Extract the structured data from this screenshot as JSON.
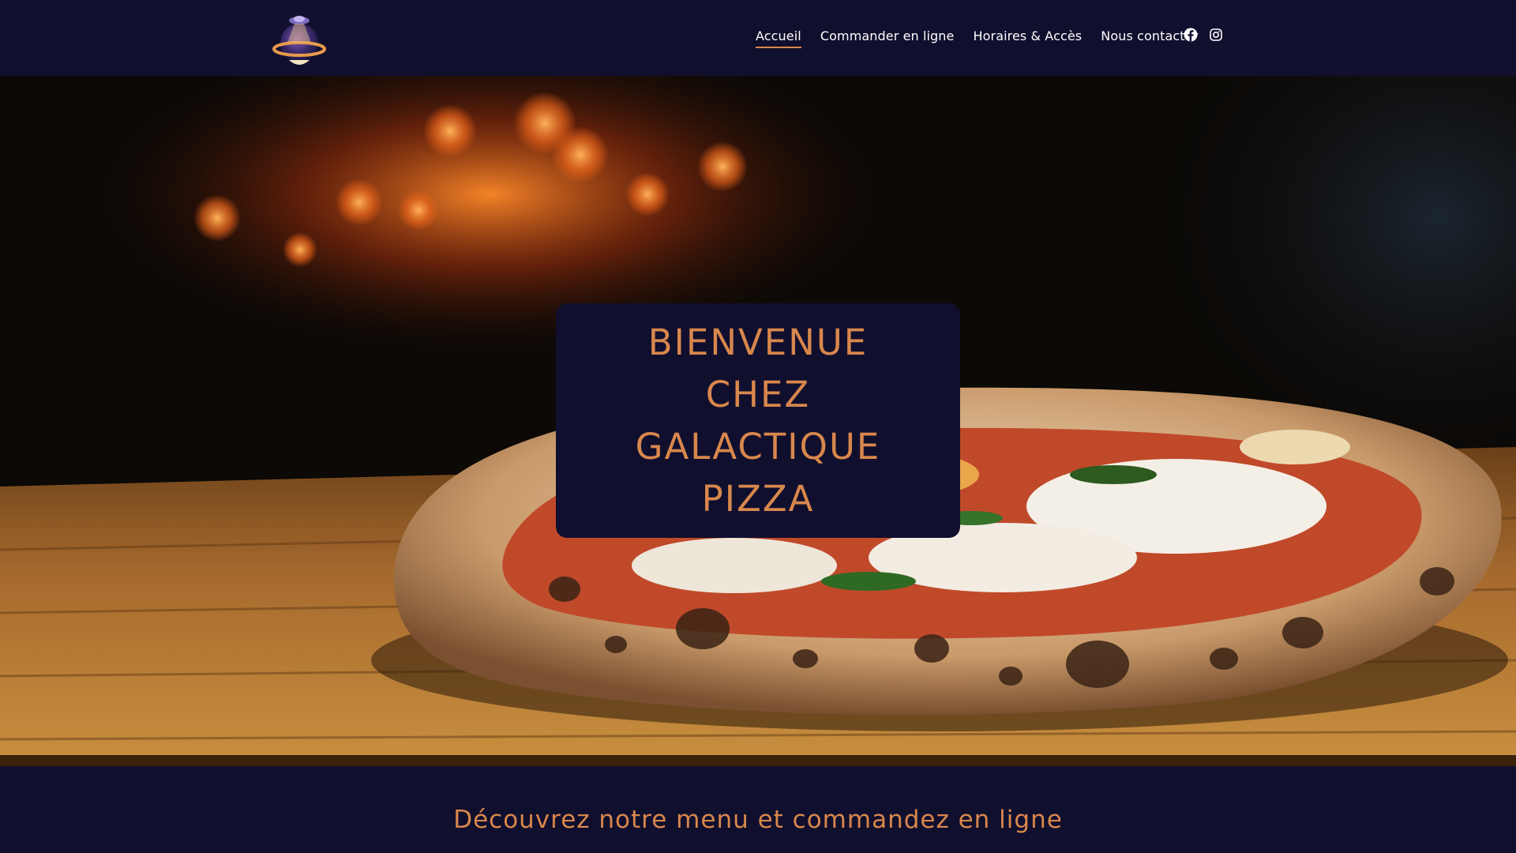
{
  "nav": {
    "items": [
      {
        "label": "Accueil",
        "active": true
      },
      {
        "label": "Commander en ligne",
        "active": false
      },
      {
        "label": "Horaires & Accès",
        "active": false
      },
      {
        "label": "Nous contacter",
        "active": false
      }
    ]
  },
  "social": {
    "icons": [
      "facebook-icon",
      "instagram-icon"
    ]
  },
  "logo": {
    "icon": "planet-pizza-logo"
  },
  "hero": {
    "title": "BIENVENUE CHEZ GALACTIQUE PIZZA",
    "image": "wood-fired-pizza-photo"
  },
  "section": {
    "title": "Découvrez notre menu et commandez en ligne"
  },
  "colors": {
    "navy": "#110f2e",
    "accent": "#d8874c",
    "nav_text": "#ffffff"
  }
}
